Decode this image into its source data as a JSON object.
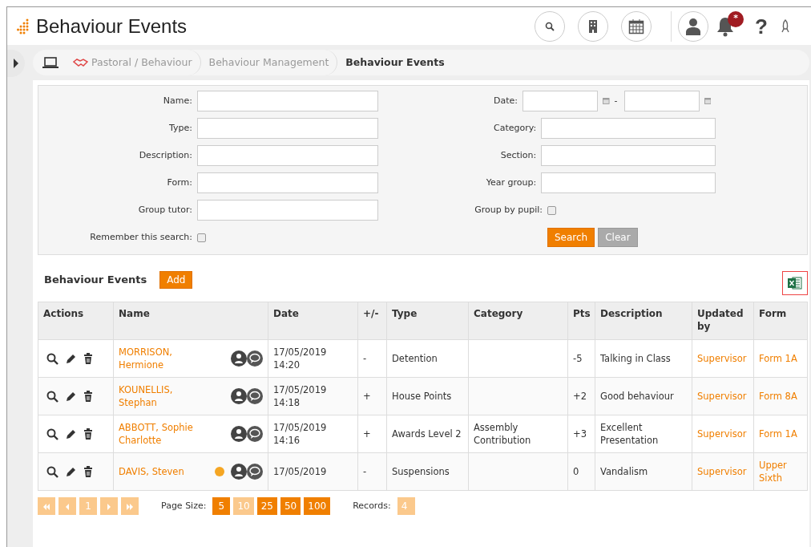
{
  "header": {
    "title": "Behaviour Events",
    "notification_badge": "*",
    "help_glyph": "?"
  },
  "breadcrumb": [
    {
      "label": "Pastoral / Behaviour",
      "kind": "module",
      "current": false
    },
    {
      "label": "Behaviour Management",
      "kind": "plain",
      "current": false
    },
    {
      "label": "Behaviour Events",
      "kind": "plain",
      "current": true
    }
  ],
  "filters": {
    "left": [
      {
        "label": "Name:",
        "kind": "text"
      },
      {
        "label": "Type:",
        "kind": "text"
      },
      {
        "label": "Description:",
        "kind": "text"
      },
      {
        "label": "Form:",
        "kind": "text"
      },
      {
        "label": "Group tutor:",
        "kind": "text"
      },
      {
        "label": "Remember this search:",
        "kind": "checkbox",
        "checked": false
      }
    ],
    "right": [
      {
        "label": "Date:",
        "kind": "daterange",
        "separator": "-"
      },
      {
        "label": "Category:",
        "kind": "text"
      },
      {
        "label": "Section:",
        "kind": "text"
      },
      {
        "label": "Year group:",
        "kind": "text"
      },
      {
        "label": "Group by pupil:",
        "kind": "checkbox",
        "checked": false
      }
    ],
    "buttons": [
      {
        "label": "Search",
        "disabled": false
      },
      {
        "label": "Clear",
        "disabled": true
      }
    ]
  },
  "events": {
    "title": "Behaviour Events",
    "add_label": "Add",
    "columns": [
      "Actions",
      "Name",
      "Date",
      "+/-",
      "Type",
      "Category",
      "Pts",
      "Description",
      "Updated by",
      "Form"
    ],
    "rows": [
      {
        "name": "MORRISON, Hermione",
        "date": "17/05/2019",
        "time": "14:20",
        "sign": "-",
        "type": "Detention",
        "pts": "-5",
        "description": "Talking in Class",
        "updated_by": "Supervisor",
        "form": "Form 1A"
      },
      {
        "name": "KOUNELLIS, Stephan",
        "date": "17/05/2019",
        "time": "14:18",
        "sign": "+",
        "type": "House Points",
        "pts": "+2",
        "description": "Good behaviour",
        "updated_by": "Supervisor",
        "form": "Form 8A"
      },
      {
        "name": "ABBOTT, Sophie Charlotte",
        "date": "17/05/2019",
        "time": "14:16",
        "sign": "+",
        "type": "Awards Level 2",
        "category": "Assembly Contribution",
        "pts": "+3",
        "description": "Excellent Presentation",
        "updated_by": "Supervisor",
        "form": "Form 1A"
      },
      {
        "name": "DAVIS, Steven",
        "color": "#f5a623",
        "date": "17/05/2019",
        "sign": "-",
        "type": "Suspensions",
        "pts": "0",
        "description": "Vandalism",
        "updated_by": "Supervisor",
        "form": "Upper Sixth"
      }
    ]
  },
  "pager": {
    "pages": [
      {
        "label": "1",
        "selected": true
      }
    ],
    "page_size_label": "Page Size:",
    "page_sizes": [
      {
        "label": "5",
        "selected": false
      },
      {
        "label": "10",
        "selected": true
      },
      {
        "label": "25",
        "selected": false
      },
      {
        "label": "50",
        "selected": false
      },
      {
        "label": "100",
        "selected": false
      }
    ],
    "records_label": "Records:",
    "records": "4"
  }
}
